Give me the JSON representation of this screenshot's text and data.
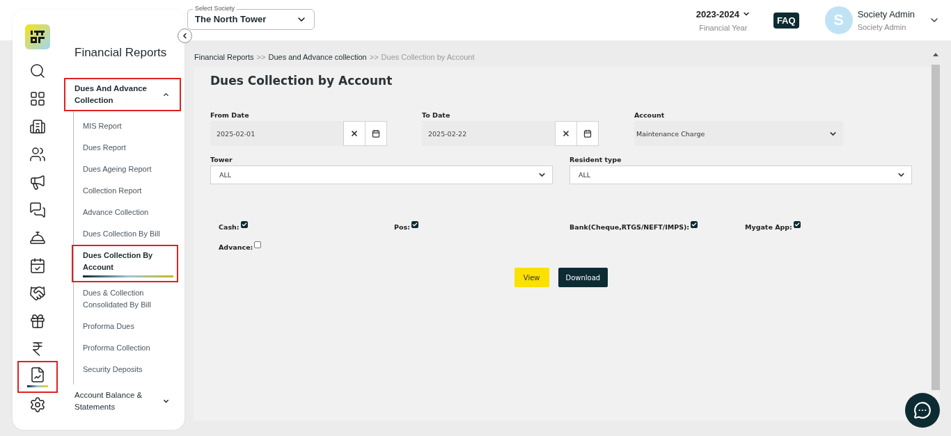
{
  "header": {
    "society": {
      "label": "Select Society",
      "value": "The North Tower"
    },
    "year": {
      "value": "2023-2024",
      "label": "Financial Year"
    },
    "faq": "FAQ",
    "user": {
      "initial": "S",
      "name": "Society Admin",
      "role": "Society Admin"
    }
  },
  "rail": [
    {
      "selected": false,
      "highlighted": false
    },
    {
      "selected": false,
      "highlighted": false
    },
    {
      "selected": false,
      "highlighted": false
    },
    {
      "selected": false,
      "highlighted": false
    },
    {
      "selected": false,
      "highlighted": false
    },
    {
      "selected": false,
      "highlighted": false
    },
    {
      "selected": false,
      "highlighted": false
    },
    {
      "selected": false,
      "highlighted": false
    },
    {
      "selected": false,
      "highlighted": false
    },
    {
      "selected": false,
      "highlighted": false
    },
    {
      "selected": false,
      "highlighted": false
    },
    {
      "selected": true,
      "highlighted": true
    },
    {
      "selected": false,
      "highlighted": false
    }
  ],
  "menu": {
    "title": "Financial Reports",
    "groups": [
      {
        "label": "Dues And Advance Collection",
        "expanded": true,
        "highlighted": true,
        "children": [
          {
            "label": "MIS Report",
            "selected": false,
            "highlighted": false
          },
          {
            "label": "Dues Report",
            "selected": false,
            "highlighted": false
          },
          {
            "label": "Dues Ageing Report",
            "selected": false,
            "highlighted": false
          },
          {
            "label": "Collection Report",
            "selected": false,
            "highlighted": false
          },
          {
            "label": "Advance Collection",
            "selected": false,
            "highlighted": false
          },
          {
            "label": "Dues Collection By Bill",
            "selected": false,
            "highlighted": false
          },
          {
            "label": "Dues Collection By Account",
            "selected": true,
            "highlighted": true
          },
          {
            "label": "Dues & Collection Consolidated By Bill",
            "selected": false,
            "highlighted": false
          },
          {
            "label": "Proforma Dues",
            "selected": false,
            "highlighted": false
          },
          {
            "label": "Proforma Collection",
            "selected": false,
            "highlighted": false
          },
          {
            "label": "Security Deposits",
            "selected": false,
            "highlighted": false
          }
        ]
      },
      {
        "label": "Account Balance & Statements",
        "expanded": false,
        "highlighted": false
      }
    ]
  },
  "breadcrumb": [
    {
      "kind": "link",
      "label": "Financial Reports"
    },
    {
      "kind": "separator",
      "label": ">>"
    },
    {
      "kind": "link",
      "label": "Dues and Advance collection"
    },
    {
      "kind": "separator",
      "label": ">>"
    },
    {
      "kind": "current",
      "label": "Dues Collection by Account"
    }
  ],
  "title": "Dues Collection by Account",
  "form": {
    "from_date": {
      "label": "From Date",
      "value": "2025-02-01"
    },
    "to_date": {
      "label": "To Date",
      "value": "2025-02-22"
    },
    "account": {
      "label": "Account",
      "value": "Maintenance Charge"
    },
    "tower": {
      "label": "Tower",
      "value": "ALL"
    },
    "resident_type": {
      "label": "Resident type",
      "value": "ALL"
    },
    "payment_modes": [
      {
        "label": "Cash:",
        "checked": true
      },
      {
        "label": "Pos:",
        "checked": true
      },
      {
        "label": "Bank(Cheque,RTGS/NEFT/IMPS):",
        "checked": true
      },
      {
        "label": "Mygate App:",
        "checked": true
      },
      {
        "label": "Advance:",
        "checked": false
      }
    ],
    "buttons": [
      {
        "label": "View",
        "kind": "primary"
      },
      {
        "label": "Download",
        "kind": "dark"
      }
    ]
  }
}
